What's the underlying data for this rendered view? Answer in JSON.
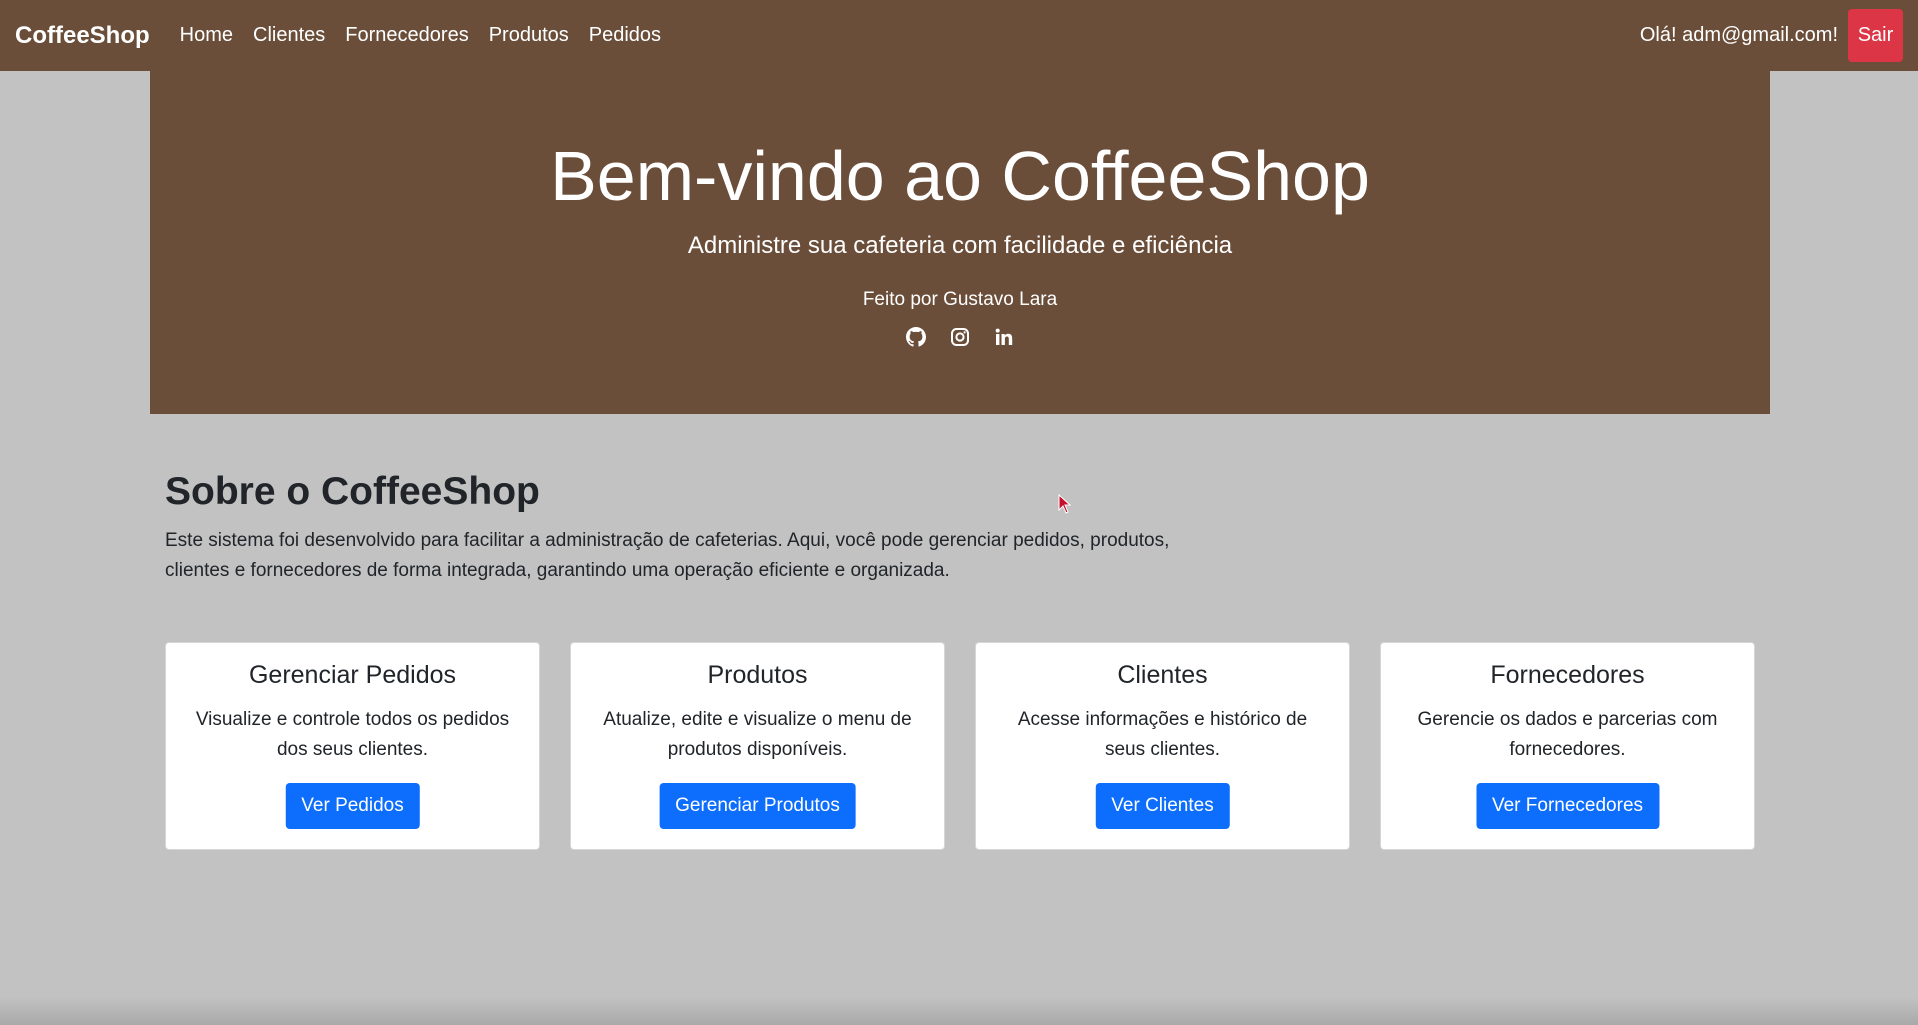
{
  "navbar": {
    "brand": "CoffeeShop",
    "links": [
      "Home",
      "Clientes",
      "Fornecedores",
      "Produtos",
      "Pedidos"
    ],
    "greeting": "Olá! adm@gmail.com!",
    "logout_label": "Sair"
  },
  "hero": {
    "title": "Bem-vindo ao CoffeeShop",
    "subtitle": "Administre sua cafeteria com facilidade e eficiência",
    "author": "Feito por Gustavo Lara",
    "social_icons": [
      "github-icon",
      "instagram-icon",
      "linkedin-icon"
    ]
  },
  "about": {
    "title": "Sobre o CoffeeShop",
    "text_line1": "Este sistema foi desenvolvido para facilitar a administração de cafeterias. Aqui, você pode gerenciar pedidos, produtos,",
    "text_line2": "clientes e fornecedores de forma integrada, garantindo uma operação eficiente e organizada."
  },
  "cards": [
    {
      "title": "Gerenciar Pedidos",
      "text_line1": "Visualize e controle todos os pedidos",
      "text_line2": "dos seus clientes.",
      "button": "Ver Pedidos"
    },
    {
      "title": "Produtos",
      "text_line1": "Atualize, edite e visualize o menu de",
      "text_line2": "produtos disponíveis.",
      "button": "Gerenciar Produtos"
    },
    {
      "title": "Clientes",
      "text_line1": "Acesse informações e histórico de",
      "text_line2": "seus clientes.",
      "button": "Ver Clientes"
    },
    {
      "title": "Fornecedores",
      "text_line1": "Gerencie os dados e parcerias com",
      "text_line2": "fornecedores.",
      "button": "Ver Fornecedores"
    }
  ],
  "colors": {
    "brown": "#6b4e3a",
    "background": "#c2c2c2",
    "primary": "#0d6efd",
    "danger": "#dc3545"
  }
}
